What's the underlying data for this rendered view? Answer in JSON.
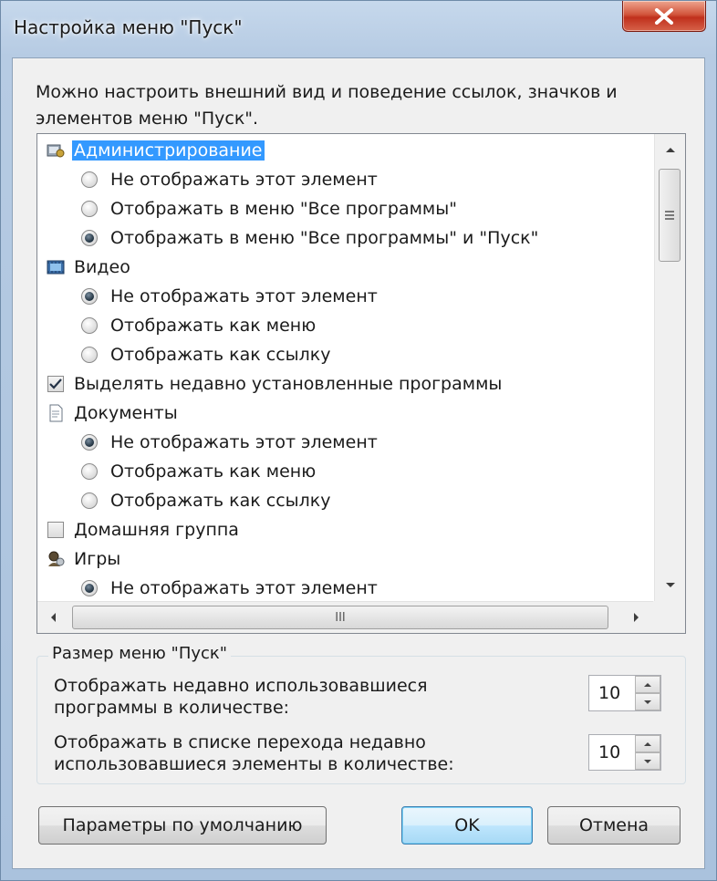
{
  "window": {
    "title": "Настройка меню \"Пуск\""
  },
  "description": "Можно настроить внешний вид и поведение ссылок, значков и элементов меню \"Пуск\".",
  "list": {
    "items": [
      {
        "type": "category",
        "icon": "admin-tools-icon",
        "label": "Администрирование",
        "selected": true
      },
      {
        "type": "radio",
        "label": "Не отображать этот элемент",
        "checked": false
      },
      {
        "type": "radio",
        "label": "Отображать в меню \"Все программы\"",
        "checked": false
      },
      {
        "type": "radio",
        "label": "Отображать в меню \"Все программы\" и \"Пуск\"",
        "checked": true
      },
      {
        "type": "category",
        "icon": "video-icon",
        "label": "Видео"
      },
      {
        "type": "radio",
        "label": "Не отображать этот элемент",
        "checked": true
      },
      {
        "type": "radio",
        "label": "Отображать как меню",
        "checked": false
      },
      {
        "type": "radio",
        "label": "Отображать как ссылку",
        "checked": false
      },
      {
        "type": "checkbox",
        "label": "Выделять недавно установленные программы",
        "checked": true
      },
      {
        "type": "category",
        "icon": "documents-icon",
        "label": "Документы"
      },
      {
        "type": "radio",
        "label": "Не отображать этот элемент",
        "checked": true
      },
      {
        "type": "radio",
        "label": "Отображать как меню",
        "checked": false
      },
      {
        "type": "radio",
        "label": "Отображать как ссылку",
        "checked": false
      },
      {
        "type": "checkbox",
        "label": "Домашняя группа",
        "checked": false
      },
      {
        "type": "category",
        "icon": "games-icon",
        "label": "Игры"
      },
      {
        "type": "radio",
        "label": "Не отображать этот элемент",
        "checked": true
      }
    ]
  },
  "start_menu_size": {
    "group_title": "Размер меню \"Пуск\"",
    "recent_programs": {
      "label_line1": "Отображать недавно использовавшиеся",
      "label_line2": "программы в количестве:",
      "value": "10"
    },
    "jump_list": {
      "label_line1": "Отображать в списке перехода недавно",
      "label_line2": "использовавшиеся элементы в количестве:",
      "value": "10"
    }
  },
  "buttons": {
    "defaults": "Параметры по умолчанию",
    "ok": "OK",
    "cancel": "Отмена"
  },
  "scrollbar": {
    "h_grip": "III"
  }
}
